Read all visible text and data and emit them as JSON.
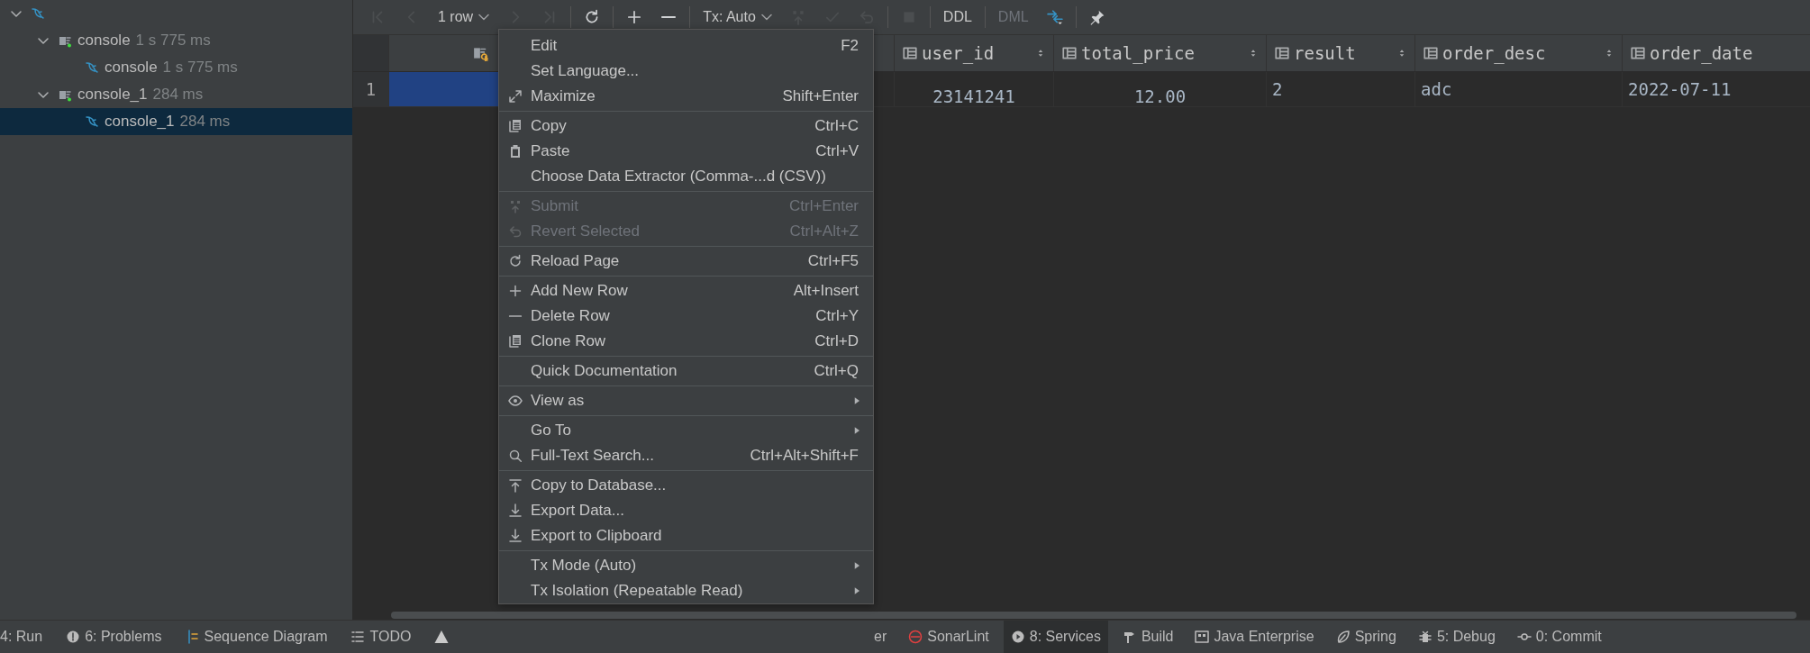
{
  "tree": [
    {
      "expanded": true,
      "selected": false,
      "children": [
        {
          "label": "console",
          "time": "1 s 775 ms",
          "expanded": true,
          "selected": false,
          "children": [
            {
              "label": "console",
              "time": "1 s 775 ms",
              "selected": false
            }
          ]
        },
        {
          "label": "console_1",
          "time": "284 ms",
          "expanded": true,
          "selected": false,
          "children": [
            {
              "label": "console_1",
              "time": "284 ms",
              "selected": true
            }
          ]
        }
      ]
    }
  ],
  "toolbar": [
    [
      {
        "kind": "icon",
        "disabled": true
      },
      {
        "kind": "icon",
        "disabled": true
      },
      {
        "kind": "dropdown",
        "label": "1 row",
        "disabled": false
      },
      {
        "kind": "icon",
        "disabled": true
      },
      {
        "kind": "icon",
        "disabled": true
      }
    ],
    [
      {
        "kind": "icon",
        "disabled": false
      }
    ],
    [
      {
        "kind": "icon",
        "disabled": false
      },
      {
        "kind": "icon",
        "disabled": false
      }
    ],
    [
      {
        "kind": "dropdown",
        "label": "Tx: Auto",
        "disabled": false
      },
      {
        "kind": "icon",
        "disabled": true
      },
      {
        "kind": "icon",
        "disabled": true
      },
      {
        "kind": "icon",
        "disabled": true
      }
    ],
    [
      {
        "kind": "icon",
        "disabled": true
      }
    ],
    [
      {
        "kind": "text",
        "label": "DDL",
        "disabled": false
      }
    ],
    [
      {
        "kind": "text",
        "label": "DML",
        "disabled": true
      },
      {
        "kind": "icon",
        "disabled": false
      }
    ],
    [
      {
        "kind": "icon",
        "disabled": false
      }
    ]
  ],
  "table": {
    "columns": [
      {
        "primary_key": true
      },
      {
        "name": "user_id",
        "numeric": true,
        "primary_key": false
      },
      {
        "name": "total_price",
        "numeric": true,
        "primary_key": false
      },
      {
        "name": "result",
        "numeric": false,
        "primary_key": false
      },
      {
        "name": "order_desc",
        "numeric": false,
        "primary_key": false
      },
      {
        "name": "order_date",
        "numeric": false,
        "primary_key": false
      }
    ],
    "rows": [
      {
        "number": "1",
        "cells": [
          {
            "selected": true
          },
          {
            "value": "23141241",
            "selected": false
          },
          {
            "value": "12.00",
            "selected": false
          },
          {
            "value": "2",
            "selected": false
          },
          {
            "value": "adc",
            "selected": false
          },
          {
            "value": "2022-07-11",
            "selected": false
          }
        ]
      }
    ]
  },
  "context_menu": [
    [
      {
        "label": "Edit",
        "shortcut": "F2",
        "disabled": false
      },
      {
        "label": "Set Language...",
        "disabled": false
      },
      {
        "label": "Maximize",
        "shortcut": "Shift+Enter",
        "disabled": false
      }
    ],
    [
      {
        "label": "Copy",
        "shortcut": "Ctrl+C",
        "disabled": false
      },
      {
        "label": "Paste",
        "shortcut": "Ctrl+V",
        "disabled": false
      },
      {
        "label": "Choose Data Extractor (Comma-...d (CSV))",
        "disabled": false
      }
    ],
    [
      {
        "label": "Submit",
        "shortcut": "Ctrl+Enter",
        "disabled": true
      },
      {
        "label": "Revert Selected",
        "shortcut": "Ctrl+Alt+Z",
        "disabled": true
      }
    ],
    [
      {
        "label": "Reload Page",
        "shortcut": "Ctrl+F5",
        "disabled": false
      }
    ],
    [
      {
        "label": "Add New Row",
        "shortcut": "Alt+Insert",
        "disabled": false
      },
      {
        "label": "Delete Row",
        "shortcut": "Ctrl+Y",
        "disabled": false
      },
      {
        "label": "Clone Row",
        "shortcut": "Ctrl+D",
        "disabled": false
      }
    ],
    [
      {
        "label": "Quick Documentation",
        "shortcut": "Ctrl+Q",
        "disabled": false
      }
    ],
    [
      {
        "label": "View as",
        "submenu": true,
        "disabled": false
      }
    ],
    [
      {
        "label": "Go To",
        "submenu": true,
        "disabled": false
      },
      {
        "label": "Full-Text Search...",
        "shortcut": "Ctrl+Alt+Shift+F",
        "disabled": false
      }
    ],
    [
      {
        "label": "Copy to Database...",
        "disabled": false
      },
      {
        "label": "Export Data...",
        "disabled": false
      },
      {
        "label": "Export to Clipboard",
        "disabled": false
      }
    ],
    [
      {
        "label": "Tx Mode (Auto)",
        "submenu": true,
        "disabled": false
      },
      {
        "label": "Tx Isolation (Repeatable Read)",
        "submenu": true,
        "disabled": false
      }
    ]
  ],
  "status_bar": {
    "left": [
      {
        "label": "4: Run",
        "selected": false
      },
      {
        "label": "6: Problems",
        "selected": false
      },
      {
        "label": "Sequence Diagram",
        "selected": false
      },
      {
        "label": "TODO",
        "selected": false
      },
      {
        "selected": false
      }
    ],
    "right": [
      {
        "label": "er",
        "selected": false
      },
      {
        "label": "SonarLint",
        "selected": false
      },
      {
        "label": "8: Services",
        "selected": true
      },
      {
        "label": "Build",
        "selected": false
      },
      {
        "label": "Java Enterprise",
        "selected": false
      },
      {
        "label": "Spring",
        "selected": false
      },
      {
        "label": "5: Debug",
        "selected": false
      },
      {
        "label": "0: Commit",
        "selected": false
      }
    ]
  }
}
